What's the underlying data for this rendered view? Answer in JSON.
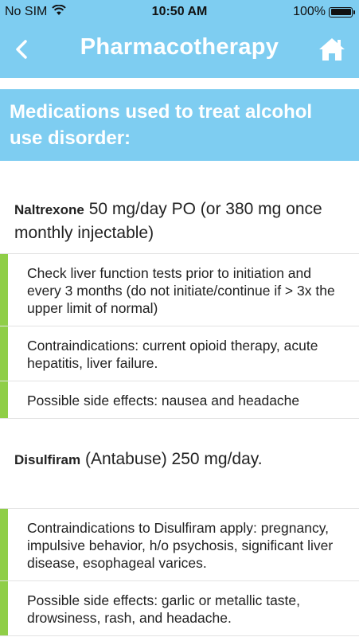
{
  "status_bar": {
    "carrier": "No SIM",
    "time": "10:50 AM",
    "battery": "100%"
  },
  "nav": {
    "title": "Pharmacotherapy",
    "back_icon": "chevron-left-icon",
    "home_icon": "home-icon"
  },
  "section": {
    "header": "Medications used to treat alcohol use disorder:"
  },
  "colors": {
    "header_blue": "#7ecdf1",
    "accent_green": "#8fce47"
  },
  "drugs": [
    {
      "name": "Naltrexone",
      "dose": " 50 mg/day PO (or 380 mg once monthly injectable)",
      "notes": [
        "Check liver function tests prior to initiation and every 3 months (do not initiate/continue if > 3x the upper limit of normal)",
        "Contraindications: current opioid therapy, acute hepatitis, liver failure.",
        "Possible side effects: nausea and headache"
      ]
    },
    {
      "name": "Disulfiram",
      "dose": " (Antabuse) 250 mg/day.",
      "notes": [
        "Contraindications to Disulfiram apply: pregnancy, impulsive behavior, h/o psychosis, significant liver disease, esophageal varices.",
        "Possible side effects: garlic or metallic taste, drowsiness, rash, and headache."
      ]
    }
  ]
}
